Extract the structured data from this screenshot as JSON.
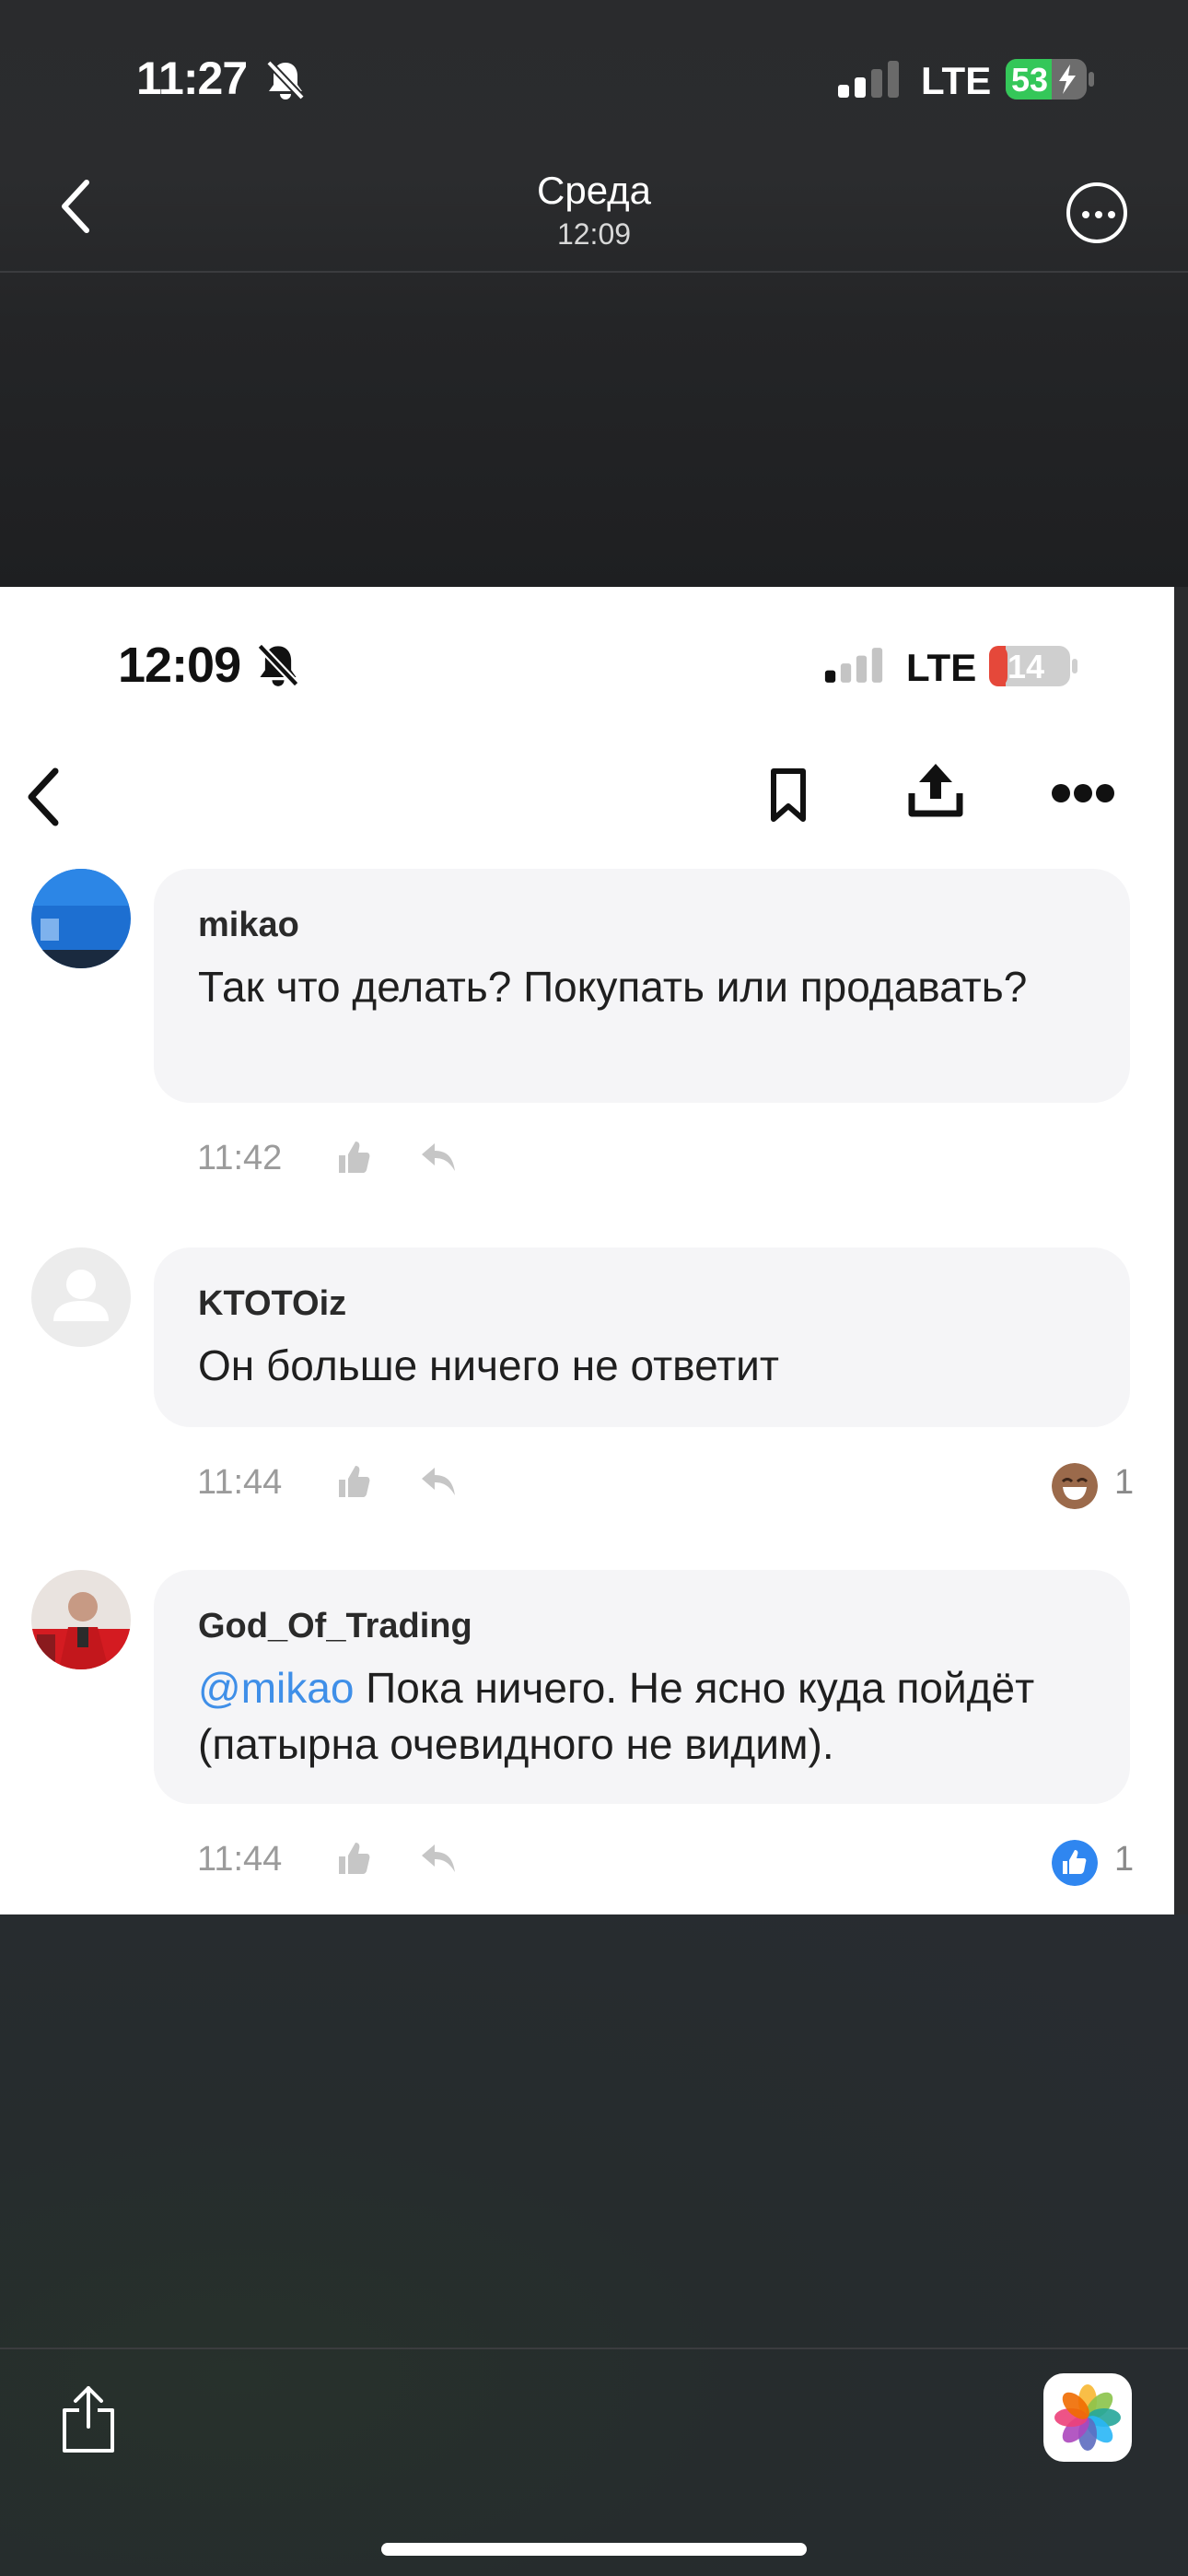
{
  "outer": {
    "status_time": "11:27",
    "network": "LTE",
    "battery": "53",
    "nav_title": "Среда",
    "nav_subtitle": "12:09"
  },
  "inner": {
    "status_time": "12:09",
    "network": "LTE",
    "battery": "14"
  },
  "comments": [
    {
      "author": "mikao",
      "text": "Так что делать? Покупать или продавать?",
      "time": "11:42",
      "reaction_count": ""
    },
    {
      "author": "KTOTOiz",
      "text": "Он больше ничего не ответит",
      "time": "11:44",
      "reaction": "laughing-emoji-icon",
      "reaction_count": "1"
    },
    {
      "author": "God_Of_Trading",
      "mention": "@mikao",
      "text": " Пока ничего. Не ясно куда пойдёт (патырна очевидного не видим).",
      "time": "11:44",
      "reaction": "thumbs-up-icon",
      "reaction_count": "1"
    }
  ],
  "colors": {
    "accent": "#3f8fe8",
    "battery_low": "#e5483a",
    "battery_charging": "#34c759"
  }
}
